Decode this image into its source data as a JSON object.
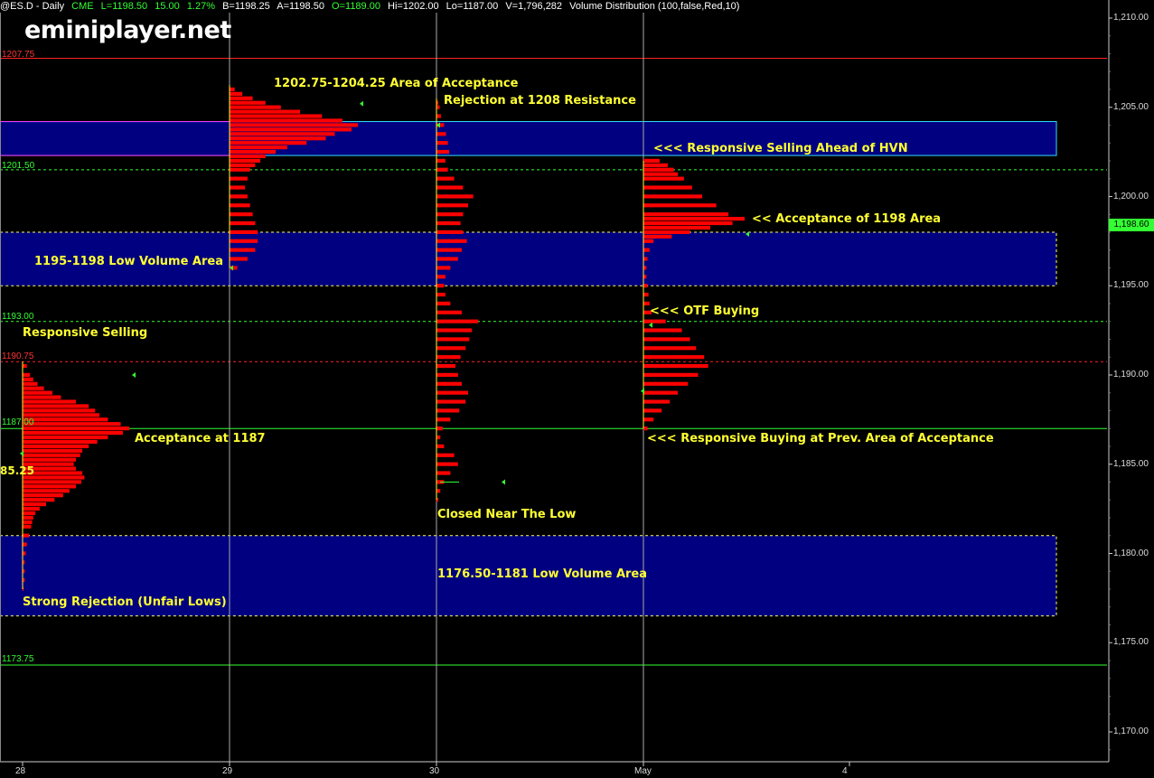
{
  "header": {
    "symbol": "@ES.D - Daily",
    "exchange": "CME",
    "last": "L=1198.50",
    "change": "15.00",
    "pct": "1.27%",
    "bid": "B=1198.25",
    "ask": "A=1198.50",
    "open": "O=1189.00",
    "high": "Hi=1202.00",
    "low": "Lo=1187.00",
    "volume": "V=1,796,282",
    "study": "Volume Distribution (100,false,Red,10)"
  },
  "logo": "eminiplayer.net",
  "last_price_label": "1,198.60",
  "level_labels": {
    "l1207": "1207.75",
    "l1201": "1201.50",
    "l1193": "1193.00",
    "l1190": "1190.75",
    "l1187": "1187.00",
    "l1173": "1173.75",
    "l1185": "85.25"
  },
  "annotations": {
    "a_acceptance_area": "1202.75-1204.25 Area of Acceptance",
    "a_rejection": "Rejection at 1208 Resistance",
    "a_resp_selling_hvn": "<<< Responsive Selling Ahead of HVN",
    "a_accept_1198": "<< Acceptance of 1198 Area",
    "a_low_vol_1195": "1195-1198 Low Volume Area",
    "a_otf_buying": "<<< OTF Buying",
    "a_resp_selling": "Responsive Selling",
    "a_accept_1187": "Acceptance at 1187",
    "a_resp_buying": "<<< Responsive Buying at Prev. Area of Acceptance",
    "a_closed_low": "Closed Near The Low",
    "a_low_vol_1176": "1176.50-1181 Low Volume Area",
    "a_strong_rejection": "Strong Rejection (Unfair Lows)"
  },
  "colors": {
    "background": "#000000",
    "profile": "#ff0000",
    "zone_fill": "#000080",
    "annotation": "#ffff33",
    "green_line": "#33ff33",
    "red_line": "#ff2222"
  },
  "chart_data": {
    "type": "volume-profile",
    "ylim": [
      1168,
      1211
    ],
    "y_ticks": [
      {
        "value": 1210,
        "label": "1,210.00"
      },
      {
        "value": 1205,
        "label": "1,205.00"
      },
      {
        "value": 1200,
        "label": "1,200.00"
      },
      {
        "value": 1195,
        "label": "1,195.00"
      },
      {
        "value": 1190,
        "label": "1,190.00"
      },
      {
        "value": 1185,
        "label": "1,185.00"
      },
      {
        "value": 1180,
        "label": "1,180.00"
      },
      {
        "value": 1175,
        "label": "1,175.00"
      },
      {
        "value": 1170,
        "label": "1,170.00"
      }
    ],
    "x_categories": [
      "28",
      "29",
      "30",
      "May",
      "4"
    ],
    "horizontal_levels": [
      {
        "price": 1207.75,
        "style": "solid",
        "color": "red"
      },
      {
        "price": 1201.5,
        "style": "dashed",
        "color": "green"
      },
      {
        "price": 1193.0,
        "style": "dashed",
        "color": "green"
      },
      {
        "price": 1190.75,
        "style": "dashed",
        "color": "red"
      },
      {
        "price": 1187.0,
        "style": "solid",
        "color": "green"
      },
      {
        "price": 1173.75,
        "style": "solid",
        "color": "green"
      }
    ],
    "zones": [
      {
        "low": 1202.3,
        "high": 1204.2,
        "style": "solid"
      },
      {
        "low": 1195.0,
        "high": 1198.0,
        "style": "dashed"
      },
      {
        "low": 1176.5,
        "high": 1181.0,
        "style": "dashed"
      }
    ],
    "profiles": [
      {
        "day": "28",
        "price_low": 1178.0,
        "price_high": 1190.75,
        "volume_profile": [
          [
            1190.5,
            4
          ],
          [
            1190.0,
            7
          ],
          [
            1189.75,
            10
          ],
          [
            1189.5,
            14
          ],
          [
            1189.25,
            20
          ],
          [
            1189.0,
            28
          ],
          [
            1188.75,
            36
          ],
          [
            1188.5,
            50
          ],
          [
            1188.25,
            62
          ],
          [
            1188.0,
            68
          ],
          [
            1187.75,
            72
          ],
          [
            1187.5,
            80
          ],
          [
            1187.25,
            92
          ],
          [
            1187.0,
            100
          ],
          [
            1186.75,
            94
          ],
          [
            1186.5,
            80
          ],
          [
            1186.25,
            70
          ],
          [
            1186.0,
            62
          ],
          [
            1185.75,
            56
          ],
          [
            1185.5,
            54
          ],
          [
            1185.25,
            50
          ],
          [
            1185.0,
            48
          ],
          [
            1184.75,
            50
          ],
          [
            1184.5,
            56
          ],
          [
            1184.25,
            58
          ],
          [
            1184.0,
            55
          ],
          [
            1183.75,
            50
          ],
          [
            1183.5,
            44
          ],
          [
            1183.25,
            38
          ],
          [
            1183.0,
            30
          ],
          [
            1182.75,
            22
          ],
          [
            1182.5,
            16
          ],
          [
            1182.25,
            12
          ],
          [
            1182.0,
            10
          ],
          [
            1181.75,
            9
          ],
          [
            1181.5,
            8
          ],
          [
            1181.0,
            6
          ],
          [
            1180.5,
            4
          ],
          [
            1180.0,
            3
          ],
          [
            1179.5,
            2
          ],
          [
            1179.0,
            2
          ],
          [
            1178.5,
            2
          ],
          [
            1178.0,
            1
          ]
        ]
      },
      {
        "day": "29",
        "price_low": 1196.0,
        "price_high": 1206.25,
        "volume_profile": [
          [
            1206.0,
            4
          ],
          [
            1205.75,
            10
          ],
          [
            1205.5,
            18
          ],
          [
            1205.25,
            28
          ],
          [
            1205.0,
            40
          ],
          [
            1204.75,
            55
          ],
          [
            1204.5,
            72
          ],
          [
            1204.25,
            88
          ],
          [
            1204.0,
            100
          ],
          [
            1203.75,
            95
          ],
          [
            1203.5,
            82
          ],
          [
            1203.25,
            75
          ],
          [
            1203.0,
            60
          ],
          [
            1202.75,
            45
          ],
          [
            1202.5,
            36
          ],
          [
            1202.25,
            28
          ],
          [
            1202.0,
            24
          ],
          [
            1201.75,
            20
          ],
          [
            1201.5,
            16
          ],
          [
            1201.0,
            14
          ],
          [
            1200.5,
            12
          ],
          [
            1200.0,
            14
          ],
          [
            1199.5,
            16
          ],
          [
            1199.0,
            18
          ],
          [
            1198.5,
            20
          ],
          [
            1198.0,
            22
          ],
          [
            1197.5,
            22
          ],
          [
            1197.0,
            20
          ],
          [
            1196.5,
            14
          ],
          [
            1196.0,
            6
          ]
        ]
      },
      {
        "day": "30",
        "price_low": 1183.0,
        "price_high": 1205.5,
        "volume_profile": [
          [
            1205.25,
            3
          ],
          [
            1205.0,
            5
          ],
          [
            1204.5,
            7
          ],
          [
            1204.0,
            12
          ],
          [
            1203.5,
            15
          ],
          [
            1203.0,
            18
          ],
          [
            1202.5,
            20
          ],
          [
            1202.0,
            14
          ],
          [
            1201.5,
            18
          ],
          [
            1201.0,
            28
          ],
          [
            1200.5,
            42
          ],
          [
            1200.0,
            58
          ],
          [
            1199.5,
            50
          ],
          [
            1199.0,
            42
          ],
          [
            1198.5,
            38
          ],
          [
            1198.0,
            42
          ],
          [
            1197.5,
            48
          ],
          [
            1197.0,
            40
          ],
          [
            1196.5,
            34
          ],
          [
            1196.0,
            22
          ],
          [
            1195.5,
            14
          ],
          [
            1195.0,
            12
          ],
          [
            1194.5,
            14
          ],
          [
            1194.0,
            22
          ],
          [
            1193.5,
            40
          ],
          [
            1193.0,
            66
          ],
          [
            1192.5,
            56
          ],
          [
            1192.0,
            52
          ],
          [
            1191.5,
            46
          ],
          [
            1191.0,
            38
          ],
          [
            1190.5,
            30
          ],
          [
            1190.0,
            34
          ],
          [
            1189.5,
            40
          ],
          [
            1189.0,
            50
          ],
          [
            1188.5,
            46
          ],
          [
            1188.0,
            36
          ],
          [
            1187.5,
            22
          ],
          [
            1187.0,
            10
          ],
          [
            1186.5,
            6
          ],
          [
            1186.0,
            12
          ],
          [
            1185.5,
            28
          ],
          [
            1185.0,
            34
          ],
          [
            1184.5,
            22
          ],
          [
            1184.0,
            12
          ],
          [
            1183.5,
            6
          ],
          [
            1183.0,
            3
          ]
        ]
      },
      {
        "day": "May",
        "price_low": 1187.0,
        "price_high": 1202.0,
        "volume_profile": [
          [
            1202.0,
            16
          ],
          [
            1201.75,
            24
          ],
          [
            1201.5,
            30
          ],
          [
            1201.25,
            34
          ],
          [
            1201.0,
            40
          ],
          [
            1200.5,
            48
          ],
          [
            1200.0,
            58
          ],
          [
            1199.5,
            72
          ],
          [
            1199.0,
            84
          ],
          [
            1198.75,
            100
          ],
          [
            1198.5,
            88
          ],
          [
            1198.25,
            66
          ],
          [
            1198.0,
            46
          ],
          [
            1197.75,
            28
          ],
          [
            1197.5,
            10
          ],
          [
            1197.0,
            6
          ],
          [
            1196.5,
            4
          ],
          [
            1196.0,
            3
          ],
          [
            1195.5,
            3
          ],
          [
            1195.0,
            4
          ],
          [
            1194.5,
            5
          ],
          [
            1194.0,
            6
          ],
          [
            1193.5,
            8
          ],
          [
            1193.0,
            22
          ],
          [
            1192.5,
            38
          ],
          [
            1192.0,
            46
          ],
          [
            1191.5,
            52
          ],
          [
            1191.0,
            60
          ],
          [
            1190.5,
            64
          ],
          [
            1190.0,
            54
          ],
          [
            1189.5,
            44
          ],
          [
            1189.0,
            34
          ],
          [
            1188.5,
            26
          ],
          [
            1188.0,
            18
          ],
          [
            1187.5,
            10
          ],
          [
            1187.0,
            4
          ]
        ]
      }
    ]
  }
}
